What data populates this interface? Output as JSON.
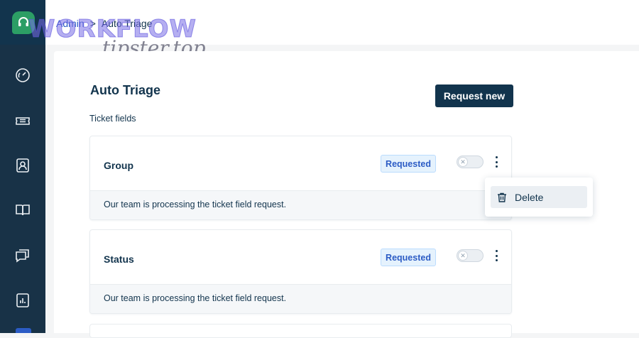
{
  "breadcrumb": {
    "parent": "Admin",
    "separator": ">",
    "current": "Auto Triage"
  },
  "watermark": {
    "line1": "WORKFLOW",
    "line2": "tipster.top"
  },
  "sidebar": {
    "items": [
      {
        "icon": "dashboard-icon"
      },
      {
        "icon": "ticket-icon"
      },
      {
        "icon": "contact-icon"
      },
      {
        "icon": "book-icon"
      },
      {
        "icon": "chat-icon"
      },
      {
        "icon": "reports-icon"
      }
    ]
  },
  "page": {
    "title": "Auto Triage",
    "request_button": "Request new",
    "section_label": "Ticket fields"
  },
  "fields": [
    {
      "name": "Group",
      "status": "Requested",
      "enabled": false,
      "message": "Our team is processing the ticket field request."
    },
    {
      "name": "Status",
      "status": "Requested",
      "enabled": false,
      "message": "Our team is processing the ticket field request."
    }
  ],
  "menu": {
    "delete_label": "Delete"
  },
  "colors": {
    "sidebar": "#183247",
    "brand": "#2c9e65",
    "primary_button": "#12344d",
    "badge_text": "#2c5cc5",
    "badge_bg": "#e5f2fd"
  }
}
